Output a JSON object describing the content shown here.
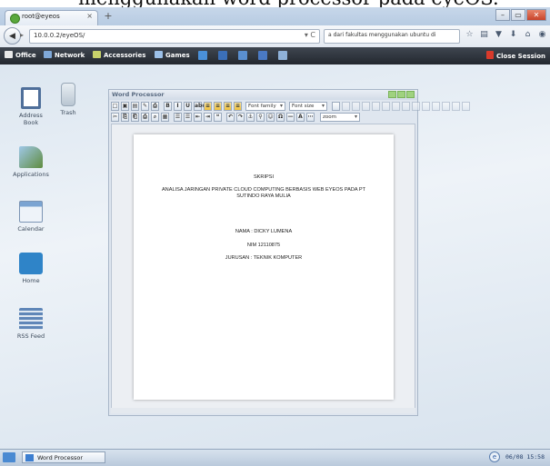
{
  "page_caption": "menggunakan word processor pada eyeOS.",
  "browser": {
    "tab_title": "root@eyeos",
    "tab_close": "×",
    "new_tab": "+",
    "url": "10.0.0.2/eyeOS/",
    "search_text": "a dari fakultas menggunakan ubuntu di",
    "window_controls": [
      "–",
      "▭",
      "✕"
    ]
  },
  "taskbar": {
    "items": [
      {
        "label": "Office",
        "color": "#e8e8e8"
      },
      {
        "label": "Network",
        "color": "#7fa8d8"
      },
      {
        "label": "Accessories",
        "color": "#c9d36b"
      },
      {
        "label": "Games",
        "color": "#9cc0e8"
      }
    ],
    "quick_colors": [
      "#4a90d9",
      "#3b6fb8",
      "#5a8fd0",
      "#4a79c3",
      "#8fb1d8"
    ],
    "close_session": "Close Session"
  },
  "desktop_icons": [
    {
      "label": "Address Book",
      "color": "#4f6f9a"
    },
    {
      "label": "Trash",
      "color": "#c9d3dc"
    },
    {
      "label": "Applications",
      "color": "#5f8c3f"
    },
    {
      "label": "Calendar",
      "color": "#7ba4d2"
    },
    {
      "label": "Home",
      "color": "#2f84c8"
    },
    {
      "label": "RSS Feed",
      "color": "#5f86b8"
    }
  ],
  "word_processor": {
    "title": "Word Processor",
    "font_family_label": "Font family",
    "font_size_label": "Font size",
    "zoom_label": "zoom",
    "toolbar_row1": [
      "□",
      "▣",
      "▤",
      "✎",
      "⎙",
      "B",
      "I",
      "U",
      "abc",
      "≡",
      "≡",
      "≡",
      "≡"
    ],
    "toolbar_row2": [
      "✂",
      "⎘",
      "⎗",
      "⎙",
      "⌕",
      "▦",
      "☰",
      "☰",
      "⇤",
      "⇥",
      "❝",
      "↶",
      "↷",
      "⚓",
      "⚲",
      "☺",
      "Ω",
      "—",
      "A",
      "⋯"
    ]
  },
  "document": {
    "title": "SKRIPSI",
    "subtitle_line1": "ANALISA JARINGAN PRIVATE CLOUD COMPUTING BERBASIS WEB EYEOS PADA PT",
    "subtitle_line2": "SUTINDO RAYA MULIA",
    "name": "NAMA : DICKY LUMENA",
    "nim": "NIM 12110875",
    "jurusan": "JURUSAN : TEKNIK KOMPUTER"
  },
  "bottom_bar": {
    "task_label": "Word Processor",
    "clock": "06/08  15:58"
  }
}
